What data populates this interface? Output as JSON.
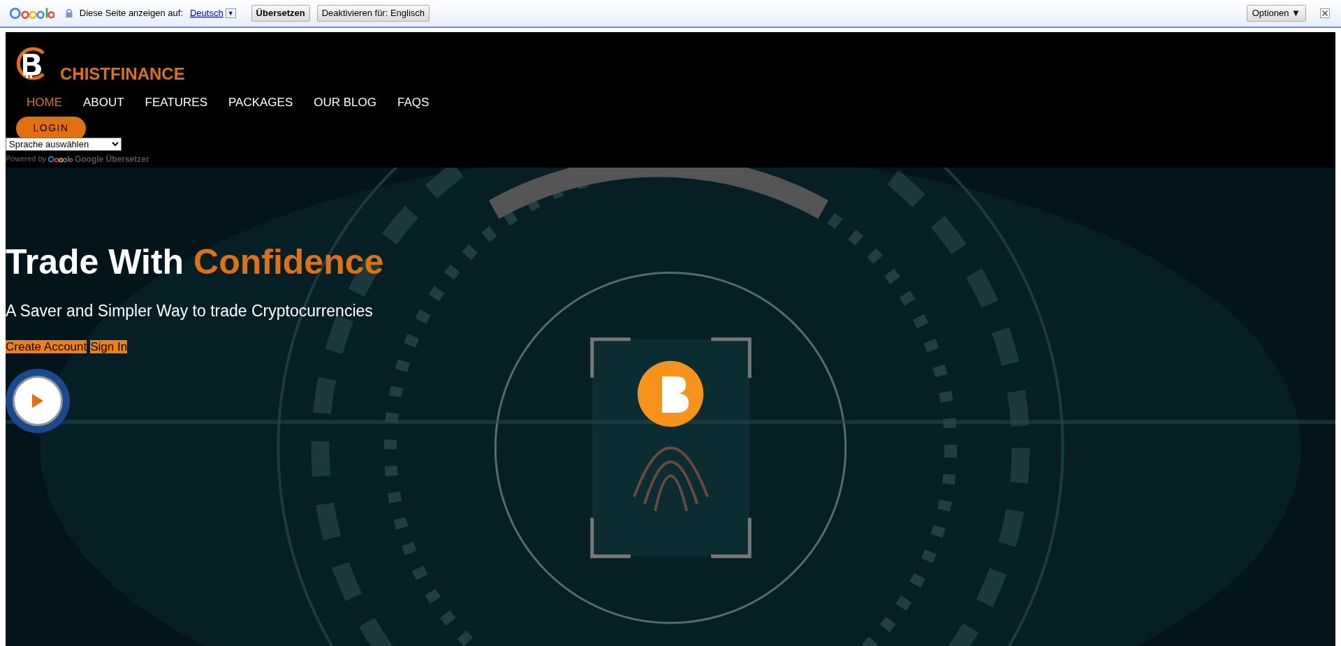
{
  "translate_bar": {
    "prompt": "Diese Seite anzeigen auf:",
    "language": "Deutsch",
    "language_caret": "▼",
    "translate_button": "Übersetzen",
    "disable_button": "Deaktivieren für: Englisch",
    "options_button": "Optionen ▼"
  },
  "header": {
    "brand": "CHISTFINANCE",
    "nav": [
      {
        "label": "HOME",
        "selected": true
      },
      {
        "label": "ABOUT",
        "selected": false
      },
      {
        "label": "FEATURES",
        "selected": false
      },
      {
        "label": "PACKAGES",
        "selected": false
      },
      {
        "label": "OUR BLOG",
        "selected": false
      },
      {
        "label": "FAQS",
        "selected": false
      }
    ],
    "login_button": "LOGIN",
    "language_select": "Sprache auswählen",
    "powered_by": "Powered by",
    "powered_brand": "Google Übersetzer"
  },
  "hero": {
    "title": "Trade With",
    "title_accent": "Confidence",
    "subtitle": "A Saver and Simpler Way to trade Cryptocurrencies",
    "buttons": [
      "Create Account",
      "Sign In"
    ]
  }
}
